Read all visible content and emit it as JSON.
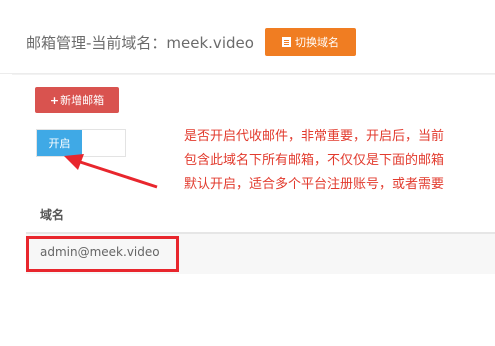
{
  "header": {
    "title": "邮箱管理-当前域名：meek.video",
    "switch_domain_label": "切换域名"
  },
  "toolbar": {
    "add_mailbox_label": "新增邮箱",
    "add_mailbox_prefix": "+"
  },
  "toggle": {
    "state_label": "开启",
    "enabled": true
  },
  "annotation": {
    "lines": [
      "是否开启代收邮件，非常重要，开启后，当前",
      "包含此域名下所有邮箱，不仅仅是下面的邮箱",
      "默认开启，适合多个平台注册账号，或者需要"
    ],
    "color": "#e23b2e"
  },
  "table": {
    "columns": [
      "域名"
    ],
    "rows": [
      {
        "email": "admin@meek.video"
      }
    ]
  },
  "colors": {
    "switch_button": "#f07d22",
    "add_button": "#d9534f",
    "toggle_on": "#3fa9e6",
    "highlight": "#e8262d"
  },
  "icons": {
    "switch_button_icon": "document-icon",
    "annotation_arrow": "arrow-icon"
  }
}
